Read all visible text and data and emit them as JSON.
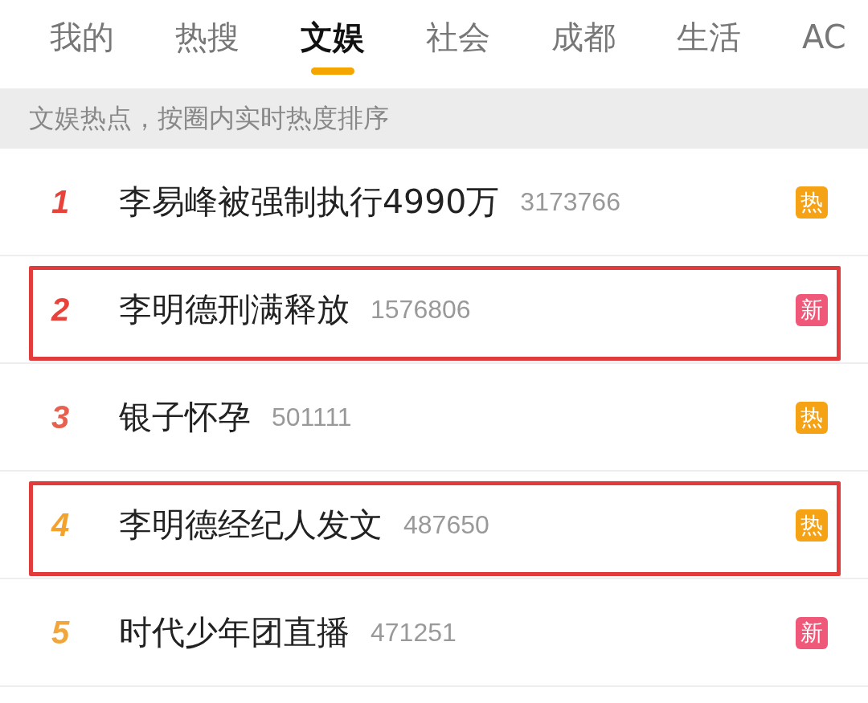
{
  "tabs": [
    {
      "label": "我的",
      "selected": false
    },
    {
      "label": "热搜",
      "selected": false
    },
    {
      "label": "文娱",
      "selected": true
    },
    {
      "label": "社会",
      "selected": false
    },
    {
      "label": "成都",
      "selected": false
    },
    {
      "label": "生活",
      "selected": false
    },
    {
      "label": "AC",
      "selected": false
    }
  ],
  "banner": "文娱热点，按圈内实时热度排序",
  "rows": [
    {
      "rank": "1",
      "title": "李易峰被强制执行4990万",
      "count": "3173766",
      "badge": {
        "kind": "hot",
        "text": "热"
      },
      "highlighted": false
    },
    {
      "rank": "2",
      "title": "李明德刑满释放",
      "count": "1576806",
      "badge": {
        "kind": "new",
        "text": "新"
      },
      "highlighted": true
    },
    {
      "rank": "3",
      "title": "银子怀孕",
      "count": "501111",
      "badge": {
        "kind": "hot",
        "text": "热"
      },
      "highlighted": false
    },
    {
      "rank": "4",
      "title": "李明德经纪人发文",
      "count": "487650",
      "badge": {
        "kind": "hot",
        "text": "热"
      },
      "highlighted": true
    },
    {
      "rank": "5",
      "title": "时代少年团直播",
      "count": "471251",
      "badge": {
        "kind": "new",
        "text": "新"
      },
      "highlighted": false
    }
  ]
}
